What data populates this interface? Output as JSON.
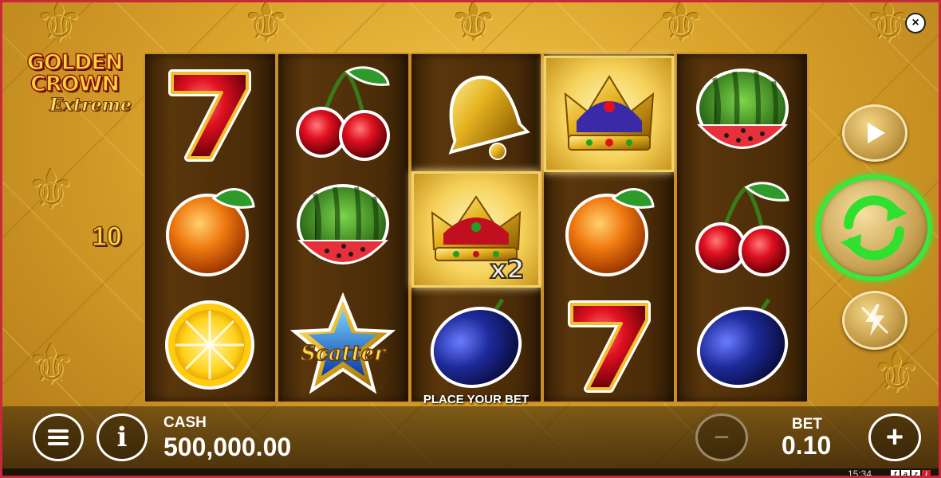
{
  "game": {
    "logo_line1": "GOLDEN",
    "logo_line2": "CROWN",
    "logo_line3": "Extreme",
    "lines_count": "10",
    "close_icon": "×"
  },
  "reels": [
    [
      "seven",
      "orange",
      "lemon"
    ],
    [
      "cherry",
      "watermelon",
      "scatter-star"
    ],
    [
      "bell",
      "crown-x2",
      "plum"
    ],
    [
      "crown",
      "orange",
      "seven"
    ],
    [
      "watermelon",
      "cherry",
      "plum"
    ]
  ],
  "highlighted_cells": [
    "reel-3-row-2",
    "reel-4-row-1"
  ],
  "symbols": {
    "scatter_text": "Scatter",
    "multiplier_text": "x2"
  },
  "message": "PLACE YOUR BET",
  "controls": {
    "play_icon": "play-icon",
    "spin_icon": "spin-arrows-icon",
    "turbo_icon": "lightning-icon",
    "menu_icon": "menu-icon",
    "info_text": "i",
    "minus_text": "−",
    "plus_text": "+"
  },
  "cash": {
    "label": "CASH",
    "value": "500,000.00"
  },
  "bet": {
    "label": "BET",
    "value": "0.10"
  },
  "status": {
    "time": "15:34",
    "brand": [
      "f",
      "a",
      "z",
      "i"
    ]
  },
  "colors": {
    "spin_ring": "#39e83a",
    "frame_border": "#c8283a",
    "brand_red": "#d81e2a"
  }
}
